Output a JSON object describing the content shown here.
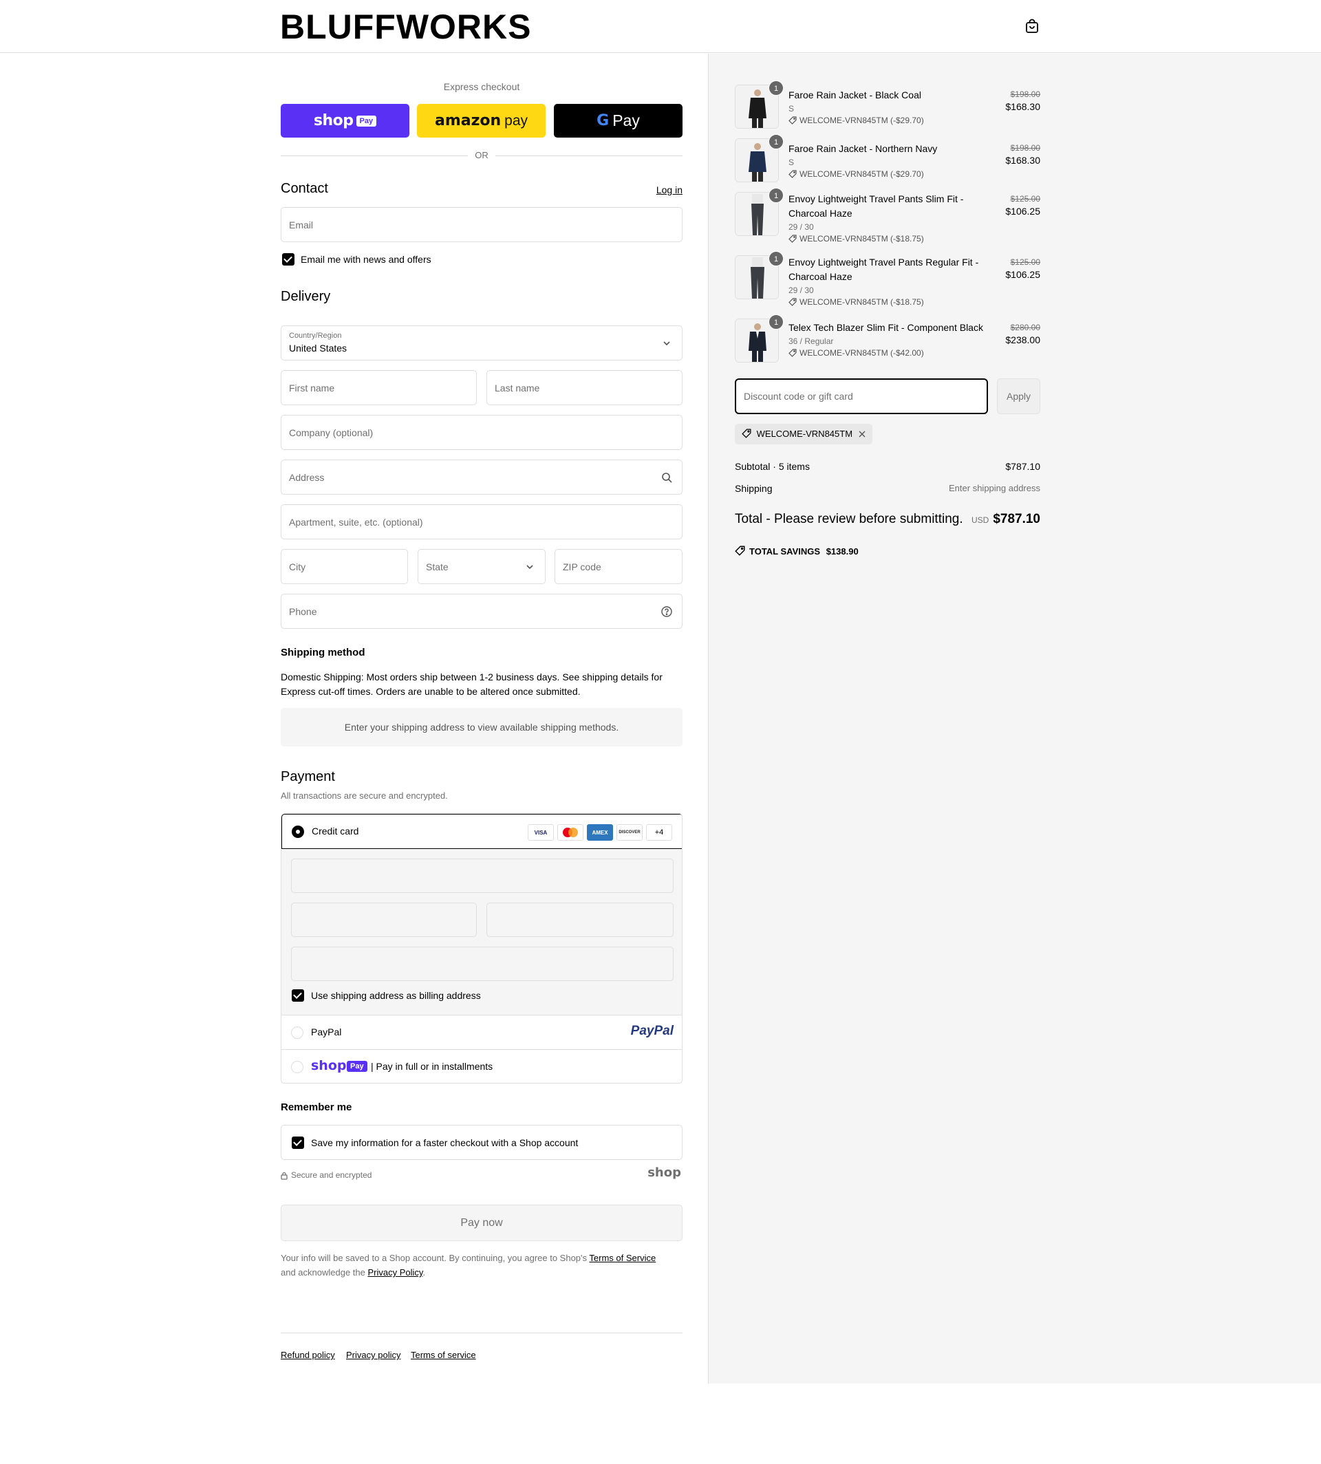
{
  "header": {
    "logo": "BLUFFWORKS",
    "cart_icon": "shopping-bag-icon"
  },
  "express": {
    "label": "Express checkout",
    "shop_word": "shop",
    "shop_tag": "Pay",
    "amazon_word": "amazon",
    "amazon_pay": "pay",
    "gpay_g": "G",
    "gpay_word": "Pay",
    "or": "OR"
  },
  "contact": {
    "title": "Contact",
    "login": "Log in",
    "email_placeholder": "Email",
    "news_label": "Email me with news and offers"
  },
  "delivery": {
    "title": "Delivery",
    "country_label": "Country/Region",
    "country_value": "United States",
    "first_name": "First name",
    "last_name": "Last name",
    "company": "Company (optional)",
    "address": "Address",
    "apartment": "Apartment, suite, etc. (optional)",
    "city": "City",
    "state": "State",
    "zip": "ZIP code",
    "phone": "Phone"
  },
  "shipping": {
    "title": "Shipping method",
    "text": "Domestic Shipping: Most orders ship between 1-2 business days. See shipping details for Express cut-off times. Orders are unable to be altered once submitted.",
    "box": "Enter your shipping address to view available shipping methods."
  },
  "payment": {
    "title": "Payment",
    "subtitle": "All transactions are secure and encrypted.",
    "credit_card": "Credit card",
    "cards": [
      "VISA",
      "MC",
      "AMEX",
      "DISCOVER"
    ],
    "more_cards": "+4",
    "billing_label": "Use shipping address as billing address",
    "paypal": "PayPal",
    "paypal_logo": "PayPal",
    "shoppay_word": "shop",
    "shoppay_tag": "Pay",
    "shoppay_text": "| Pay in full or in installments"
  },
  "remember": {
    "title": "Remember me",
    "save_label": "Save my information for a faster checkout with a Shop account",
    "secure": "Secure and encrypted",
    "shop_logo": "shop"
  },
  "pay_now": "Pay now",
  "legal": {
    "text_1": "Your info will be saved to a Shop account. By continuing, you agree to Shop's ",
    "terms": "Terms of Service",
    "text_2": "and acknowledge the ",
    "privacy": "Privacy Policy",
    "text_3": "."
  },
  "footer": {
    "refund": "Refund policy",
    "privacy": "Privacy policy",
    "terms": "Terms of service"
  },
  "summary": {
    "items": [
      {
        "name": "Faroe Rain Jacket - Black Coal",
        "variant": "S",
        "discount": "WELCOME-VRN845TM (-$29.70)",
        "old_price": "$198.00",
        "price": "$168.30",
        "qty": "1",
        "color": "#1a1a1a"
      },
      {
        "name": "Faroe Rain Jacket - Northern Navy",
        "variant": "S",
        "discount": "WELCOME-VRN845TM (-$29.70)",
        "old_price": "$198.00",
        "price": "$168.30",
        "qty": "1",
        "color": "#1f2f4f"
      },
      {
        "name": "Envoy Lightweight Travel Pants Slim Fit - Charcoal Haze",
        "variant": "29 / 30",
        "discount": "WELCOME-VRN845TM (-$18.75)",
        "old_price": "$125.00",
        "price": "$106.25",
        "qty": "1",
        "color": "#3a3d42"
      },
      {
        "name": "Envoy Lightweight Travel Pants Regular Fit - Charcoal Haze",
        "variant": "29 / 30",
        "discount": "WELCOME-VRN845TM (-$18.75)",
        "old_price": "$125.00",
        "price": "$106.25",
        "qty": "1",
        "color": "#3a3d42"
      },
      {
        "name": "Telex Tech Blazer Slim Fit - Component Black",
        "variant": "36 / Regular",
        "discount": "WELCOME-VRN845TM (-$42.00)",
        "old_price": "$280.00",
        "price": "$238.00",
        "qty": "1",
        "color": "#1c2230"
      }
    ],
    "discount_placeholder": "Discount code or gift card",
    "apply": "Apply",
    "applied_code": "WELCOME-VRN845TM",
    "subtotal_label": "Subtotal · 5 items",
    "subtotal": "$787.10",
    "shipping_label": "Shipping",
    "shipping_value": "Enter shipping address",
    "total_label": "Total - Please review before submitting.",
    "currency": "USD",
    "total": "$787.10",
    "savings_label": "TOTAL SAVINGS",
    "savings": "$138.90"
  }
}
